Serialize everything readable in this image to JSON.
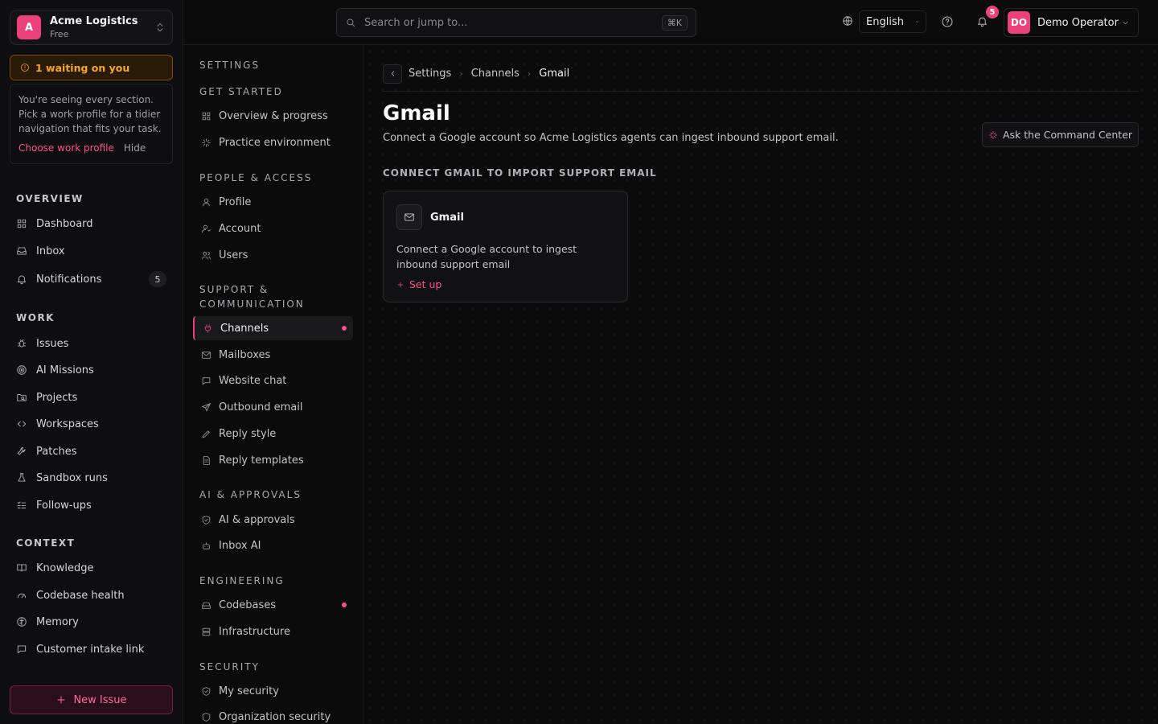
{
  "org": {
    "initial": "A",
    "name": "Acme Logistics",
    "plan": "Free"
  },
  "waiting": {
    "label": "1 waiting on you"
  },
  "profile_hint": {
    "text": "You're seeing every section. Pick a work profile for a tidier navigation that fits your task.",
    "choose": "Choose work profile",
    "hide": "Hide"
  },
  "sidebar": {
    "overview_title": "OVERVIEW",
    "overview": [
      {
        "label": "Dashboard",
        "icon": "grid-icon"
      },
      {
        "label": "Inbox",
        "icon": "inbox-icon"
      },
      {
        "label": "Notifications",
        "icon": "bell-icon",
        "badge": "5"
      }
    ],
    "work_title": "WORK",
    "work": [
      {
        "label": "Issues",
        "icon": "bug-icon"
      },
      {
        "label": "AI Missions",
        "icon": "target-icon"
      },
      {
        "label": "Projects",
        "icon": "folder-search-icon"
      },
      {
        "label": "Workspaces",
        "icon": "code-icon"
      },
      {
        "label": "Patches",
        "icon": "wrench-icon"
      },
      {
        "label": "Sandbox runs",
        "icon": "flask-icon"
      },
      {
        "label": "Follow-ups",
        "icon": "list-check-icon"
      }
    ],
    "context_title": "CONTEXT",
    "context": [
      {
        "label": "Knowledge",
        "icon": "book-icon"
      },
      {
        "label": "Codebase health",
        "icon": "gauge-icon"
      },
      {
        "label": "Memory",
        "icon": "brain-icon"
      },
      {
        "label": "Customer intake link",
        "icon": "message-icon"
      }
    ],
    "new_issue": "New Issue"
  },
  "settings_nav": {
    "title": "SETTINGS",
    "get_started_title": "GET STARTED",
    "get_started": [
      "Overview & progress",
      "Practice environment"
    ],
    "people_title": "PEOPLE & ACCESS",
    "people": [
      "Profile",
      "Account",
      "Users"
    ],
    "support_title_1": "SUPPORT &",
    "support_title_2": "COMMUNICATION",
    "support": [
      "Channels",
      "Mailboxes",
      "Website chat",
      "Outbound email",
      "Reply style",
      "Reply templates"
    ],
    "ai_title": "AI & APPROVALS",
    "ai": [
      "AI & approvals",
      "Inbox AI"
    ],
    "eng_title": "ENGINEERING",
    "eng": [
      "Codebases",
      "Infrastructure"
    ],
    "security_title": "SECURITY",
    "security": [
      "My security",
      "Organization security"
    ]
  },
  "topbar": {
    "search_placeholder": "Search or jump to...",
    "shortcut": "⌘K",
    "language": "English",
    "notification_count": "5",
    "user_initials": "DO",
    "user_name": "Demo Operator"
  },
  "main": {
    "breadcrumb": [
      "Settings",
      "Channels",
      "Gmail"
    ],
    "title": "Gmail",
    "description": "Connect a Google account so Acme Logistics agents can ingest inbound support email.",
    "ask_button": "Ask the Command Center",
    "section_title": "CONNECT GMAIL TO IMPORT SUPPORT EMAIL",
    "card": {
      "title": "Gmail",
      "description": "Connect a Google account to ingest inbound support email",
      "action": "Set up"
    }
  },
  "colors": {
    "accent": "#ec407a",
    "warning": "#f5a623",
    "background": "#0b0b0c"
  }
}
